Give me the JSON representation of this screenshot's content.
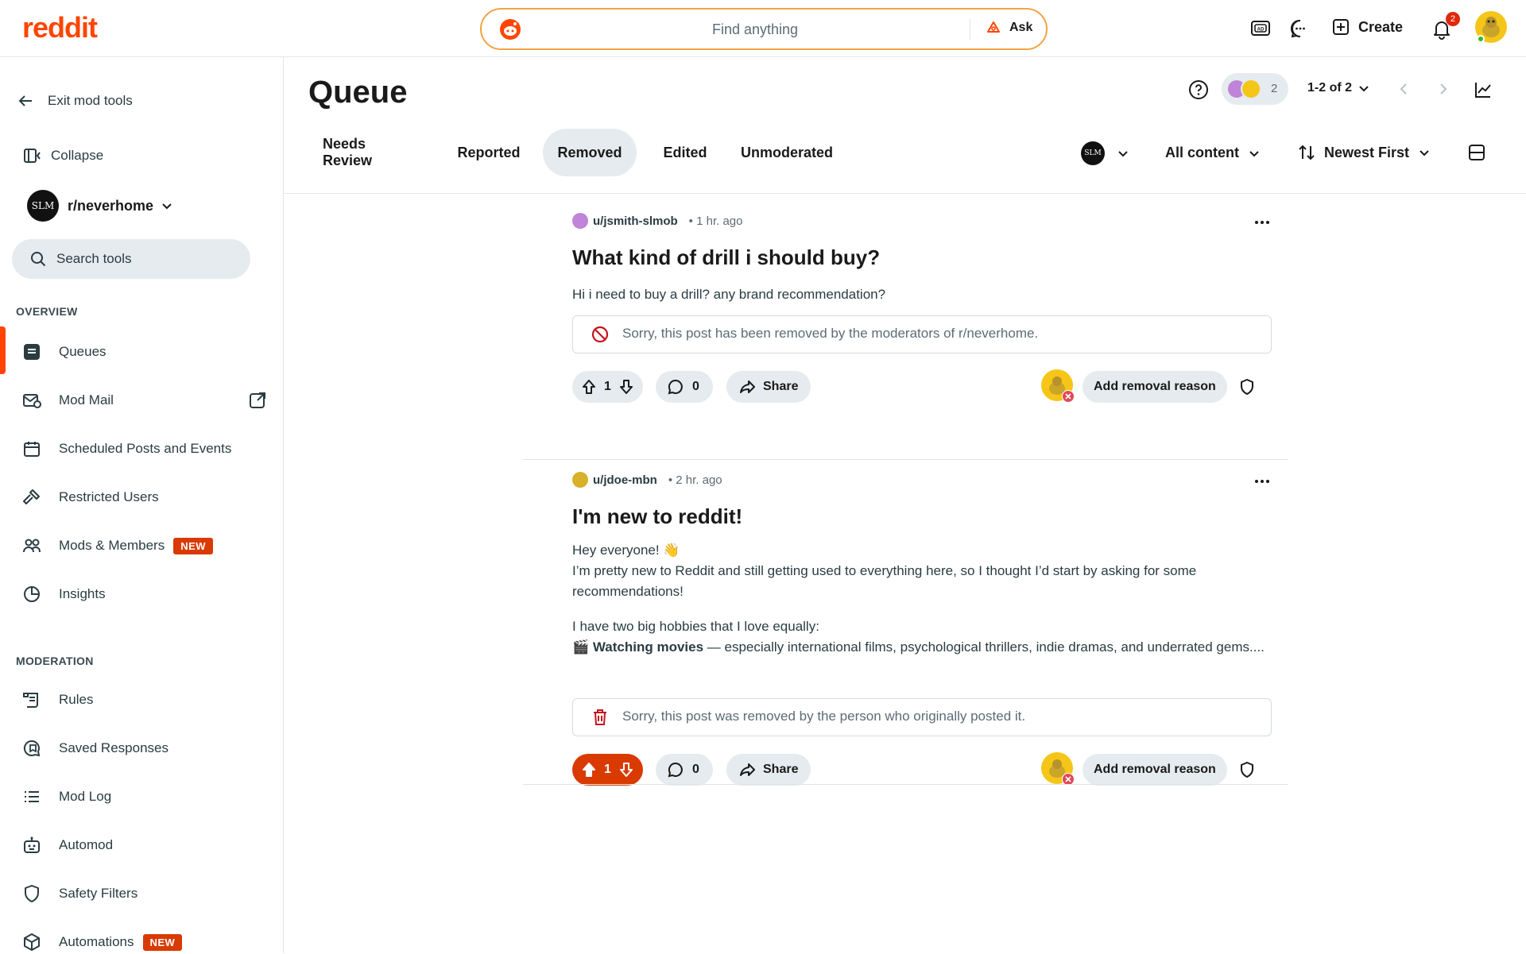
{
  "topbar": {
    "logo": "reddit",
    "search_placeholder": "Find anything",
    "ask_label": "Ask",
    "create_label": "Create",
    "notification_count": "2"
  },
  "sidebar": {
    "exit_label": "Exit mod tools",
    "collapse_label": "Collapse",
    "community_avatar_text": "SLM",
    "community_name": "r/neverhome",
    "search_tools_placeholder": "Search tools",
    "overview_header": "OVERVIEW",
    "overview_items": [
      {
        "label": "Queues",
        "icon": "queue-icon"
      },
      {
        "label": "Mod Mail",
        "icon": "mail-icon"
      },
      {
        "label": "Scheduled Posts and Events",
        "icon": "calendar-icon"
      },
      {
        "label": "Restricted Users",
        "icon": "hammer-icon"
      },
      {
        "label": "Mods & Members",
        "icon": "members-icon",
        "badge": "NEW"
      },
      {
        "label": "Insights",
        "icon": "pie-chart-icon"
      }
    ],
    "moderation_header": "MODERATION",
    "moderation_items": [
      {
        "label": "Rules",
        "icon": "rules-icon"
      },
      {
        "label": "Saved Responses",
        "icon": "saved-responses-icon"
      },
      {
        "label": "Mod Log",
        "icon": "list-icon"
      },
      {
        "label": "Automod",
        "icon": "robot-icon"
      },
      {
        "label": "Safety Filters",
        "icon": "shield-icon"
      },
      {
        "label": "Automations",
        "icon": "cube-icon",
        "badge": "NEW"
      }
    ]
  },
  "main": {
    "title": "Queue",
    "mod_count": "2",
    "pagination": "1-2 of 2",
    "tabs": [
      "Needs Review",
      "Reported",
      "Removed",
      "Edited",
      "Unmoderated"
    ],
    "active_tab": "Removed",
    "filter_avatar_text": "SLM",
    "content_filter": "All content",
    "sort": "Newest First"
  },
  "posts": [
    {
      "author": "u/jsmith-slmob",
      "time": "• 1 hr. ago",
      "title": "What kind of drill i should buy?",
      "body": [
        "Hi i need to buy a drill? any brand recommendation?"
      ],
      "notice": "Sorry, this post has been removed by the moderators of r/neverhome.",
      "votes": "1",
      "upvoted": false,
      "comments": "0",
      "share_label": "Share",
      "removal_label": "Add removal reason"
    },
    {
      "author": "u/jdoe-mbn",
      "time": "• 2 hr. ago",
      "title": "I'm new to reddit!",
      "body_line1": "Hey everyone! 👋",
      "body_line2": "I’m pretty new to Reddit and still getting used to everything here, so I thought I’d start by asking for some recommendations!",
      "body_line3": "I have two big hobbies that I love equally:",
      "body_bold": "🎬 Watching movies",
      "body_line4": " — especially international films, psychological thrillers, indie dramas, and underrated gems....",
      "notice": "Sorry, this post was removed by the person who originally posted it.",
      "votes": "1",
      "upvoted": true,
      "comments": "0",
      "share_label": "Share",
      "removal_label": "Add removal reason"
    }
  ],
  "colors": {
    "brand": "#ff4500",
    "upvote": "#d93a00",
    "pill_bg": "#e5ebee",
    "removed_icon": "#c4151c"
  }
}
